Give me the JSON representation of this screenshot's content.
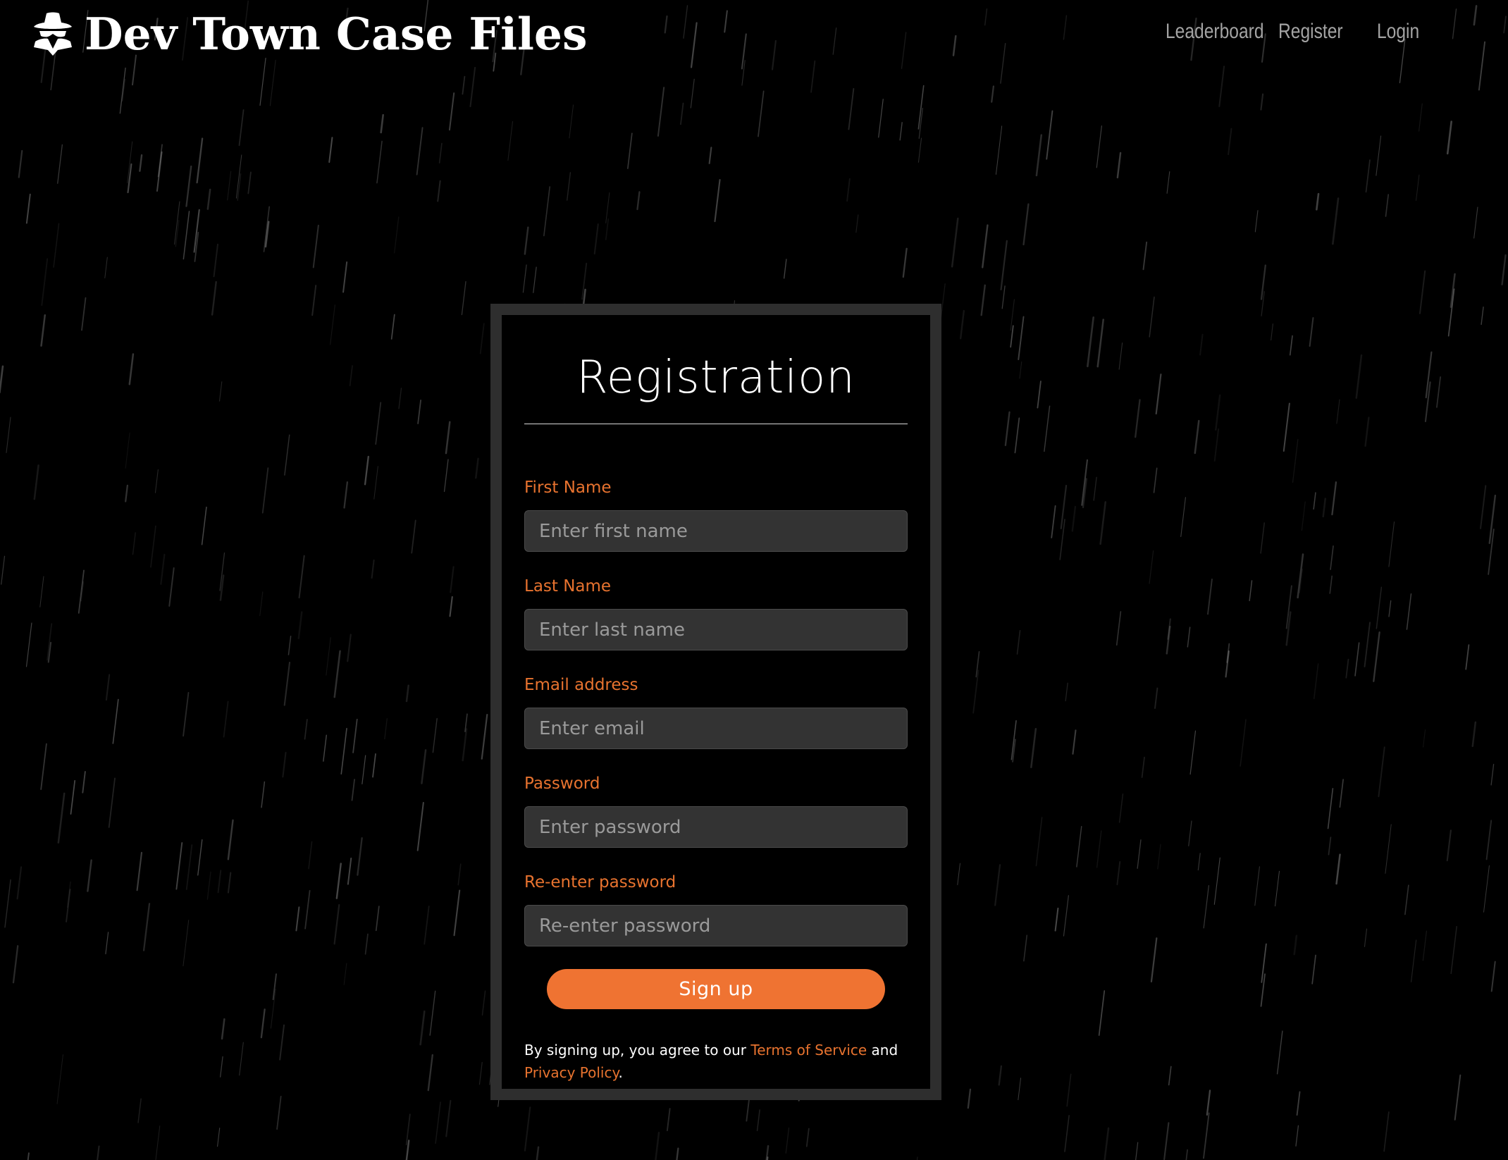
{
  "header": {
    "title": "Dev Town Case Files",
    "logo_icon": "detective-icon",
    "nav": [
      {
        "label": "Leaderboard"
      },
      {
        "label": "Register"
      },
      {
        "label": "Login"
      }
    ]
  },
  "form": {
    "title": "Registration",
    "fields": [
      {
        "label": "First Name",
        "placeholder": "Enter first name",
        "value": ""
      },
      {
        "label": "Last Name",
        "placeholder": "Enter last name",
        "value": ""
      },
      {
        "label": "Email address",
        "placeholder": "Enter email",
        "value": ""
      },
      {
        "label": "Password",
        "placeholder": "Enter password",
        "value": ""
      },
      {
        "label": "Re-enter password",
        "placeholder": "Re-enter password",
        "value": ""
      }
    ],
    "submit_label": "Sign up",
    "terms": {
      "prefix": "By signing up, you agree to our ",
      "tos_link": "Terms of Service",
      "middle": " and ",
      "privacy_link": "Privacy Policy",
      "suffix": "."
    }
  },
  "colors": {
    "background": "#000000",
    "accent": "#ef7332",
    "label": "#e8732f",
    "card_border": "#2e2e2e",
    "input_bg": "#333333",
    "nav_text": "#a3a3a3"
  }
}
